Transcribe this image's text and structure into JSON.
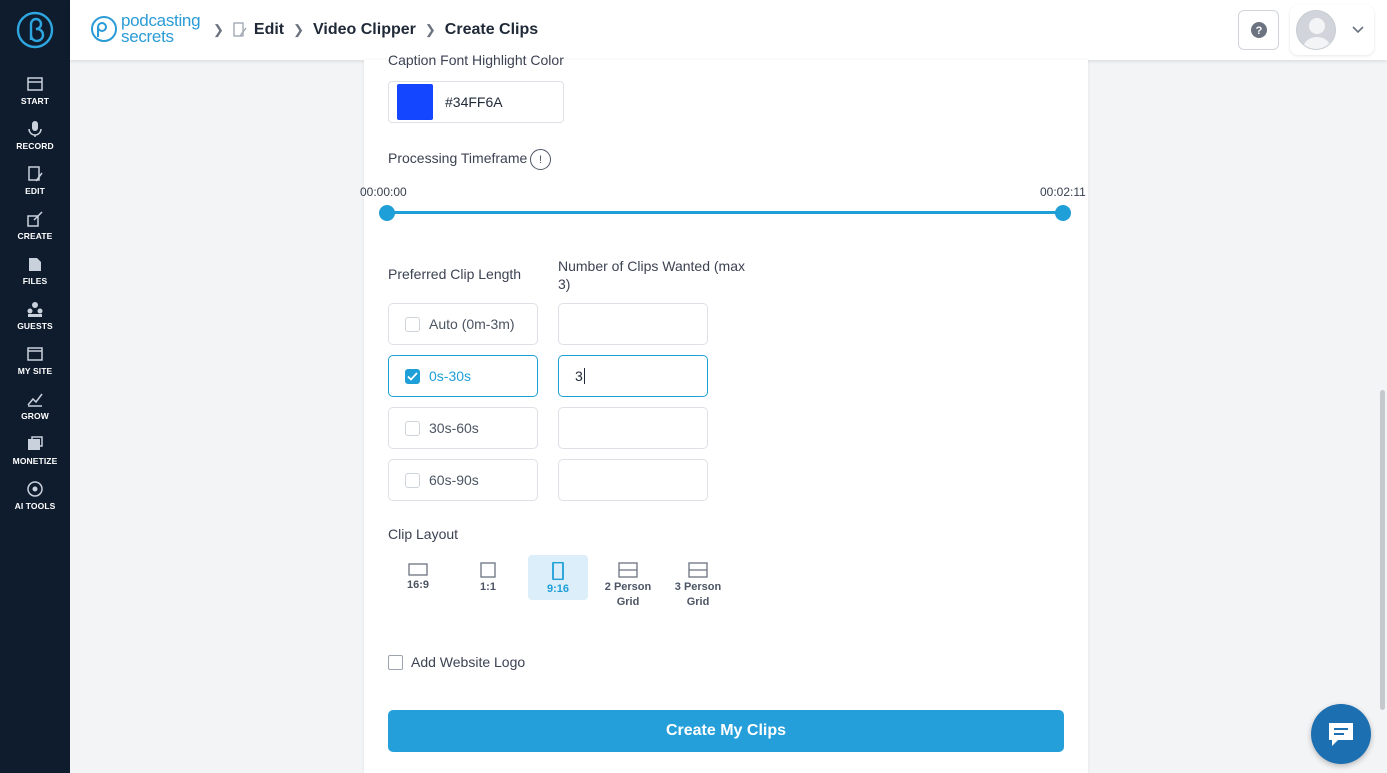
{
  "sidebar": {
    "items": [
      {
        "label": "START",
        "icon": "start-icon"
      },
      {
        "label": "RECORD",
        "icon": "microphone-icon"
      },
      {
        "label": "EDIT",
        "icon": "edit-icon"
      },
      {
        "label": "CREATE",
        "icon": "create-icon"
      },
      {
        "label": "FILES",
        "icon": "files-icon"
      },
      {
        "label": "GUESTS",
        "icon": "guests-icon"
      },
      {
        "label": "MY SITE",
        "icon": "my-site-icon"
      },
      {
        "label": "GROW",
        "icon": "grow-icon"
      },
      {
        "label": "MONETIZE",
        "icon": "monetize-icon"
      },
      {
        "label": "AI TOOLS",
        "icon": "ai-tools-icon"
      }
    ]
  },
  "header": {
    "brand_line1": "podcasting",
    "brand_line2": "secrets",
    "breadcrumbs": [
      "Edit",
      "Video Clipper",
      "Create Clips"
    ]
  },
  "form": {
    "highlight_color_label": "Caption Font Highlight Color",
    "highlight_color_value": "#34FF6A",
    "highlight_swatch_color": "#1446ff",
    "timeframe_label": "Processing Timeframe",
    "timeframe_info": "!",
    "timeframe_start": "00:00:00",
    "timeframe_end": "00:02:11",
    "clip_length_label": "Preferred Clip Length",
    "clips_wanted_label": "Number of Clips Wanted (max 3)",
    "clip_options": [
      {
        "label": "Auto (0m-3m)",
        "checked": false,
        "count": ""
      },
      {
        "label": "0s-30s",
        "checked": true,
        "count": "3"
      },
      {
        "label": "30s-60s",
        "checked": false,
        "count": ""
      },
      {
        "label": "60s-90s",
        "checked": false,
        "count": ""
      }
    ],
    "layout_label": "Clip Layout",
    "layouts": [
      {
        "label": "16:9",
        "selected": false
      },
      {
        "label": "1:1",
        "selected": false
      },
      {
        "label": "9:16",
        "selected": true
      },
      {
        "label": "2 Person Grid",
        "selected": false
      },
      {
        "label": "3 Person Grid",
        "selected": false
      }
    ],
    "add_logo_label": "Add Website Logo",
    "submit_label": "Create My Clips"
  },
  "colors": {
    "accent": "#1f9fd8",
    "sidebar_bg": "#0f1c2e",
    "chat_bg": "#1c6fb0"
  }
}
